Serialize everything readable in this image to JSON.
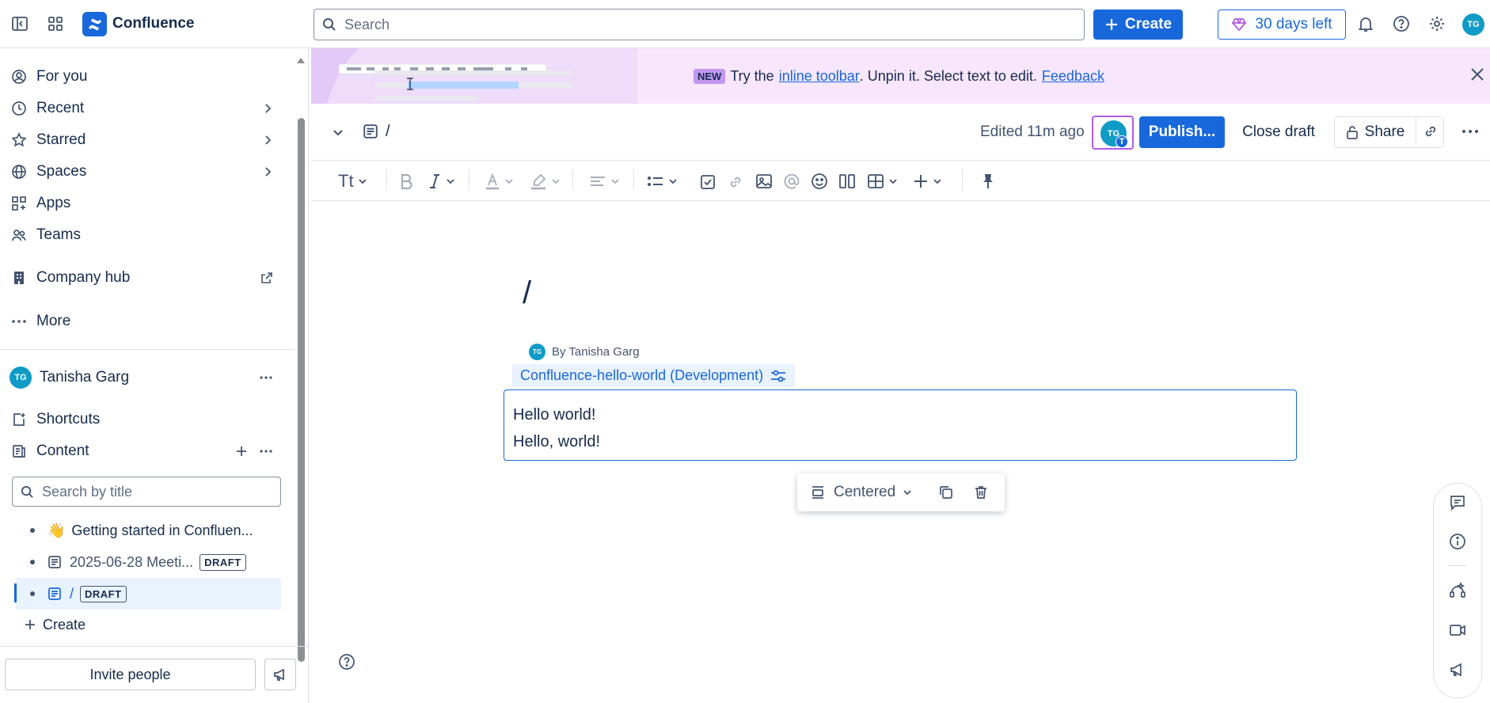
{
  "app": {
    "name": "Confluence"
  },
  "topbar": {
    "search_placeholder": "Search",
    "create_label": "Create",
    "trial_label": "30 days left",
    "avatar_initials": "TG"
  },
  "sidebar": {
    "nav": [
      {
        "label": "For you"
      },
      {
        "label": "Recent"
      },
      {
        "label": "Starred"
      },
      {
        "label": "Spaces"
      },
      {
        "label": "Apps"
      },
      {
        "label": "Teams"
      }
    ],
    "company_hub": "Company hub",
    "more": "More",
    "user": {
      "initials": "TG",
      "name": "Tanisha Garg"
    },
    "shortcuts": "Shortcuts",
    "content": "Content",
    "search_placeholder": "Search by title",
    "tree": [
      {
        "emoji": "👋",
        "label": "Getting started in Confluen..."
      },
      {
        "label": "2025-06-28 Meeti...",
        "badge": "DRAFT"
      },
      {
        "label": "/",
        "badge": "DRAFT"
      }
    ],
    "create": "Create",
    "invite": "Invite people"
  },
  "banner": {
    "tag": "NEW",
    "text_before": "Try the",
    "link": "inline toolbar",
    "text_after": ". Unpin it. Select text to edit.",
    "feedback": "Feedback"
  },
  "pagebar": {
    "crumb": "/",
    "edited": "Edited 11m ago",
    "avatar_initials": "TG",
    "avatar_badge": "T",
    "publish": "Publish...",
    "close_draft": "Close draft",
    "share": "Share"
  },
  "toolbar": {
    "text_style": "Tt"
  },
  "page": {
    "title": "/",
    "byline_initials": "TG",
    "byline": "By Tanisha Garg",
    "space": "Confluence-hello-world (Development)",
    "lines": [
      "Hello world!",
      "Hello, world!"
    ]
  },
  "floatbar": {
    "alignment": "Centered"
  }
}
